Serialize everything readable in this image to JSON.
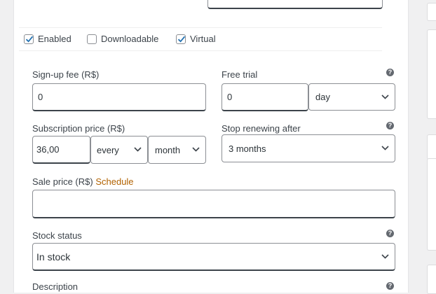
{
  "options": {
    "enabled": {
      "label": "Enabled",
      "checked": true
    },
    "downloadable": {
      "label": "Downloadable",
      "checked": false
    },
    "virtual": {
      "label": "Virtual",
      "checked": true
    }
  },
  "signup_fee": {
    "label": "Sign-up fee (R$)",
    "value": "0"
  },
  "free_trial": {
    "label": "Free trial",
    "value": "0",
    "period": "day"
  },
  "subscription_price": {
    "label": "Subscription price (R$)",
    "value": "36,00",
    "interval": "every",
    "period": "month"
  },
  "stop_renewing": {
    "label": "Stop renewing after",
    "value": "3 months"
  },
  "sale_price": {
    "label": "Sale price (R$)",
    "schedule_link": "Schedule",
    "value": ""
  },
  "stock_status": {
    "label": "Stock status",
    "value": "In stock"
  },
  "description": {
    "label": "Description"
  },
  "help_icon_text": "?",
  "colors": {
    "link": "#b26200",
    "check": "#2271b1",
    "background": "#f0f0f1"
  }
}
